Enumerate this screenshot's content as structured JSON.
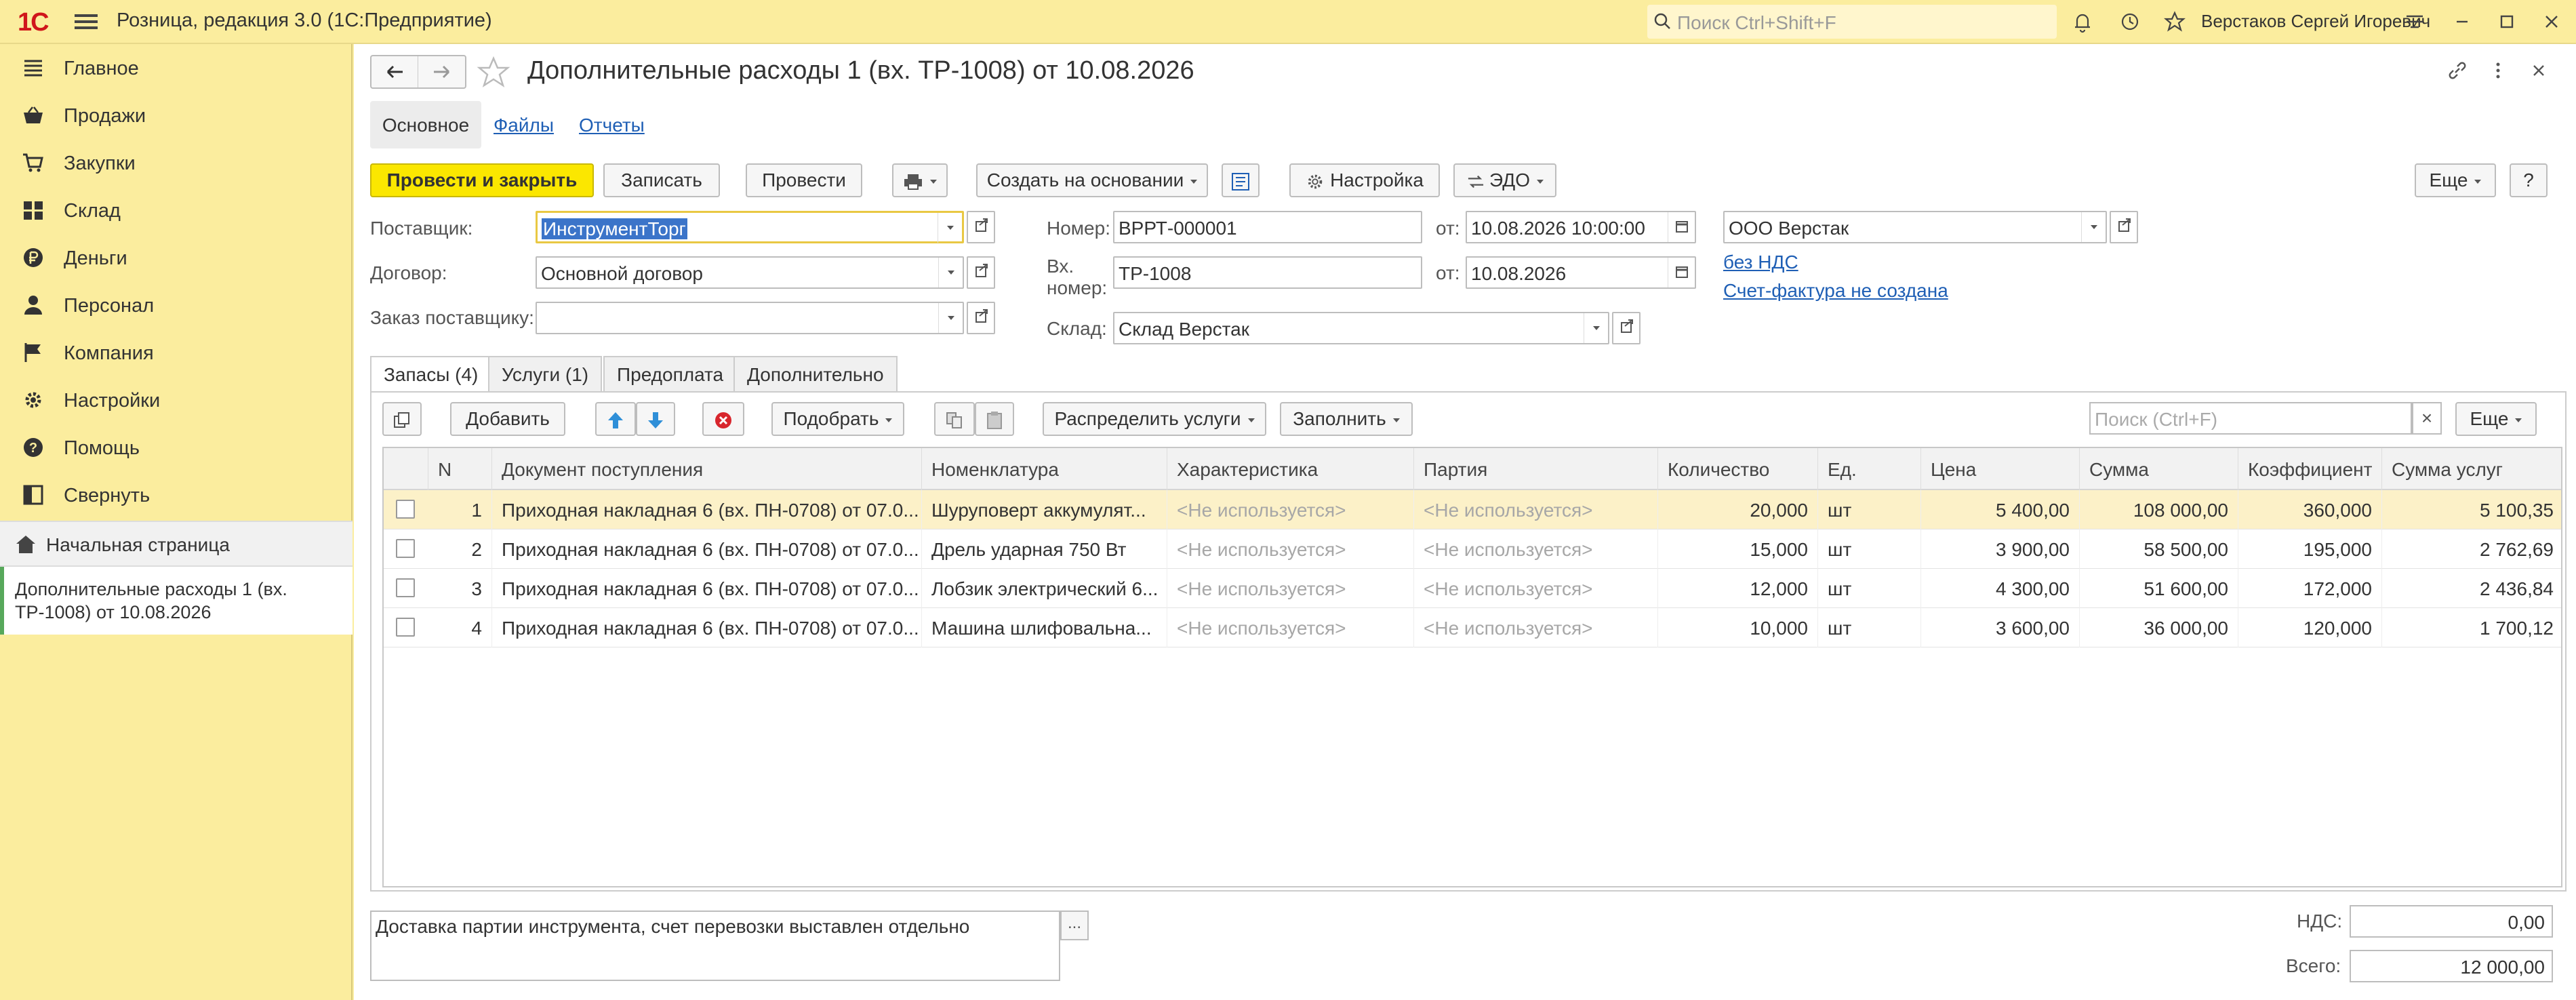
{
  "app": {
    "logo_text": "1С",
    "title": "Розница, редакция 3.0  (1С:Предприятие)",
    "search_placeholder": "Поиск Ctrl+Shift+F",
    "user": "Верстаков Сергей Игоревич"
  },
  "sidebar": {
    "items": [
      {
        "label": "Главное",
        "icon": "list-icon"
      },
      {
        "label": "Продажи",
        "icon": "basket-icon"
      },
      {
        "label": "Закупки",
        "icon": "cart-icon"
      },
      {
        "label": "Склад",
        "icon": "warehouse-icon"
      },
      {
        "label": "Деньги",
        "icon": "ruble-icon"
      },
      {
        "label": "Персонал",
        "icon": "person-icon"
      },
      {
        "label": "Компания",
        "icon": "flag-icon"
      },
      {
        "label": "Настройки",
        "icon": "gear-icon"
      },
      {
        "label": "Помощь",
        "icon": "help-icon"
      },
      {
        "label": "Свернуть",
        "icon": "collapse-icon"
      }
    ],
    "home": "Начальная страница",
    "open_document": "Дополнительные расходы 1 (вх. ТР-1008) от 10.08.2026"
  },
  "document": {
    "title": "Дополнительные расходы 1 (вх. ТР-1008) от 10.08.2026",
    "tabs": [
      "Основное",
      "Файлы",
      "Отчеты"
    ]
  },
  "toolbar": {
    "post_close": "Провести и закрыть",
    "save": "Записать",
    "post": "Провести",
    "create_based": "Создать на основании",
    "settings": "Настройка",
    "edo": "ЭДО",
    "more": "Еще",
    "help": "?"
  },
  "form": {
    "supplier_label": "Поставщик:",
    "supplier_value": "ИнструментТорг",
    "contract_label": "Договор:",
    "contract_value": "Основной договор",
    "order_label": "Заказ поставщику:",
    "order_value": "",
    "number_label": "Номер:",
    "number_value": "ВРРТ-000001",
    "in_number_label_1": "Вх.",
    "in_number_label_2": "номер:",
    "in_number_value": "ТР-1008",
    "from_label": "от:",
    "date_value": "10.08.2026 10:00:00",
    "in_date_value": "10.08.2026",
    "warehouse_label": "Склад:",
    "warehouse_value": "Склад Верстак",
    "org_value": "ООО Верстак",
    "vat_link": "без НДС",
    "invoice_link": "Счет-фактура не создана"
  },
  "table_tabs": [
    "Запасы (4)",
    "Услуги (1)",
    "Предоплата",
    "Дополнительно"
  ],
  "table_toolbar": {
    "add": "Добавить",
    "pick": "Подобрать",
    "distribute": "Распределить услуги",
    "fill": "Заполнить",
    "search_placeholder": "Поиск (Ctrl+F)",
    "clear": "×",
    "more": "Еще"
  },
  "table": {
    "columns": [
      "N",
      "Документ поступления",
      "Номенклатура",
      "Характеристика",
      "Партия",
      "Количество",
      "Ед.",
      "Цена",
      "Сумма",
      "Коэффициент",
      "Сумма услуг"
    ],
    "rows": [
      {
        "n": "1",
        "doc": "Приходная накладная 6 (вх. ПН-0708) от 07.0...",
        "item": "Шуруповерт аккумулят...",
        "char": "<Не используется>",
        "batch": "<Не используется>",
        "qty": "20,000",
        "unit": "шт",
        "price": "5 400,00",
        "sum": "108 000,00",
        "coef": "360,000",
        "service": "5 100,35"
      },
      {
        "n": "2",
        "doc": "Приходная накладная 6 (вх. ПН-0708) от 07.0...",
        "item": "Дрель ударная 750 Вт",
        "char": "<Не используется>",
        "batch": "<Не используется>",
        "qty": "15,000",
        "unit": "шт",
        "price": "3 900,00",
        "sum": "58 500,00",
        "coef": "195,000",
        "service": "2 762,69"
      },
      {
        "n": "3",
        "doc": "Приходная накладная 6 (вх. ПН-0708) от 07.0...",
        "item": "Лобзик электрический 6...",
        "char": "<Не используется>",
        "batch": "<Не используется>",
        "qty": "12,000",
        "unit": "шт",
        "price": "4 300,00",
        "sum": "51 600,00",
        "coef": "172,000",
        "service": "2 436,84"
      },
      {
        "n": "4",
        "doc": "Приходная накладная 6 (вх. ПН-0708) от 07.0...",
        "item": "Машина шлифовальна...",
        "char": "<Не используется>",
        "batch": "<Не используется>",
        "qty": "10,000",
        "unit": "шт",
        "price": "3 600,00",
        "sum": "36 000,00",
        "coef": "120,000",
        "service": "1 700,12"
      }
    ]
  },
  "footer": {
    "comment": "Доставка партии инструмента, счет перевозки выставлен отдельно",
    "ellipsis": "...",
    "vat_label": "НДС:",
    "vat_value": "0,00",
    "total_label": "Всего:",
    "total_value": "12 000,00"
  }
}
